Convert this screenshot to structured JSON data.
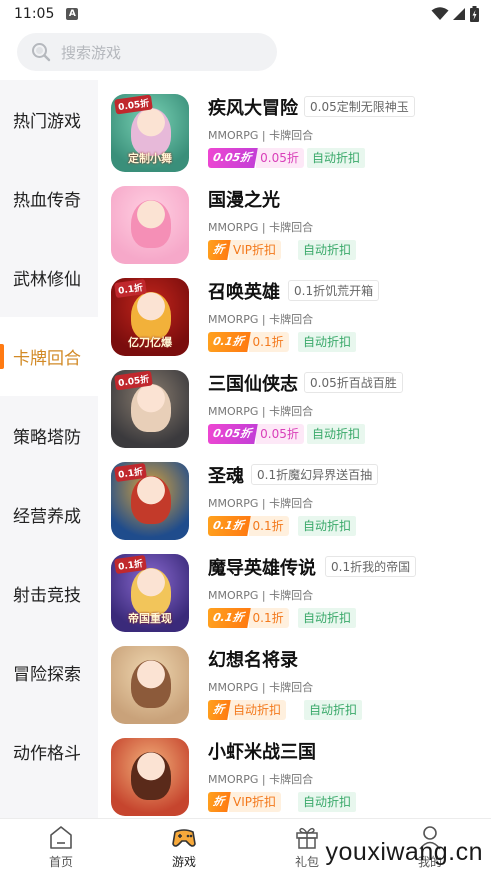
{
  "status_bar": {
    "time": "11:05",
    "notification_letter": "A"
  },
  "search": {
    "placeholder": "搜索游戏"
  },
  "sidebar": {
    "items": [
      {
        "label": "热门游戏",
        "active": false
      },
      {
        "label": "热血传奇",
        "active": false
      },
      {
        "label": "武林修仙",
        "active": false
      },
      {
        "label": "卡牌回合",
        "active": true
      },
      {
        "label": "策略塔防",
        "active": false
      },
      {
        "label": "经营养成",
        "active": false
      },
      {
        "label": "射击竞技",
        "active": false
      },
      {
        "label": "冒险探索",
        "active": false
      },
      {
        "label": "动作格斗",
        "active": false
      }
    ]
  },
  "games": [
    {
      "name": "疾风大冒险",
      "tag": "0.05定制无限神玉",
      "meta": "MMORPG | 卡牌回合",
      "pill_badge": "0.05折",
      "pill_text": "0.05折",
      "pill_style": "pink",
      "auto": "自动折扣",
      "icon_badge": "0.05折",
      "icon_banner": "定制小舞",
      "colors": [
        "#3a8f7a",
        "#7ad3b5",
        "#e7b9d9"
      ]
    },
    {
      "name": "国漫之光",
      "tag": "",
      "meta": "MMORPG | 卡牌回合",
      "pill_badge": "折",
      "pill_text": "VIP折扣",
      "pill_style": "orange",
      "auto": "自动折扣",
      "icon_badge": "",
      "icon_banner": "",
      "colors": [
        "#f6a8c9",
        "#ffd0e2",
        "#f58fb6"
      ]
    },
    {
      "name": "召唤英雄",
      "tag": "0.1折饥荒开箱",
      "meta": "MMORPG | 卡牌回合",
      "pill_badge": "0.1折",
      "pill_text": "0.1折",
      "pill_style": "orange",
      "auto": "自动折扣",
      "icon_badge": "0.1折",
      "icon_banner": "亿刀亿爆",
      "colors": [
        "#7a0d0d",
        "#c4261c",
        "#f2b13a"
      ]
    },
    {
      "name": "三国仙侠志",
      "tag": "0.05折百战百胜",
      "meta": "MMORPG | 卡牌回合",
      "pill_badge": "0.05折",
      "pill_text": "0.05折",
      "pill_style": "pink",
      "auto": "自动折扣",
      "icon_badge": "0.05折",
      "icon_banner": "",
      "colors": [
        "#3b3a3d",
        "#8a7d6f",
        "#e8cfb8"
      ]
    },
    {
      "name": "圣魂",
      "tag": "0.1折魔幻异界送百抽",
      "meta": "MMORPG | 卡牌回合",
      "pill_badge": "0.1折",
      "pill_text": "0.1折",
      "pill_style": "orange",
      "auto": "自动折扣",
      "icon_badge": "0.1折",
      "icon_banner": "",
      "colors": [
        "#1f4c8c",
        "#d9a33a",
        "#c33a2a"
      ]
    },
    {
      "name": "魔导英雄传说",
      "tag": "0.1折我的帝国",
      "meta": "MMORPG | 卡牌回合",
      "pill_badge": "0.1折",
      "pill_text": "0.1折",
      "pill_style": "orange",
      "auto": "自动折扣",
      "icon_badge": "0.1折",
      "icon_banner": "帝国重现",
      "colors": [
        "#3a2a7a",
        "#8a6ad0",
        "#f2c55a"
      ]
    },
    {
      "name": "幻想名将录",
      "tag": "",
      "meta": "MMORPG | 卡牌回合",
      "pill_badge": "折",
      "pill_text": "自动折扣",
      "pill_style": "orange",
      "auto": "自动折扣",
      "icon_badge": "",
      "icon_banner": "",
      "colors": [
        "#c9a27a",
        "#efd7b0",
        "#8c5a3a"
      ]
    },
    {
      "name": "小虾米战三国",
      "tag": "",
      "meta": "MMORPG | 卡牌回合",
      "pill_badge": "折",
      "pill_text": "VIP折扣",
      "pill_style": "orange",
      "auto": "自动折扣",
      "icon_badge": "",
      "icon_banner": "",
      "colors": [
        "#c6452e",
        "#f2b07a",
        "#5a2a1a"
      ]
    }
  ],
  "bottom_nav": {
    "items": [
      {
        "label": "首页",
        "icon": "home-icon",
        "active": false
      },
      {
        "label": "游戏",
        "icon": "gamepad-icon",
        "active": true
      },
      {
        "label": "礼包",
        "icon": "gift-icon",
        "active": false
      },
      {
        "label": "我的",
        "icon": "profile-icon",
        "active": false
      }
    ]
  },
  "watermark": "youxiwang.cn",
  "colors": {
    "accent": "#ff7a12",
    "active_text": "#d28a26",
    "pink_discount": "#d93fb9",
    "orange_discount": "#f3791c",
    "auto_green": "#3aa96a"
  }
}
